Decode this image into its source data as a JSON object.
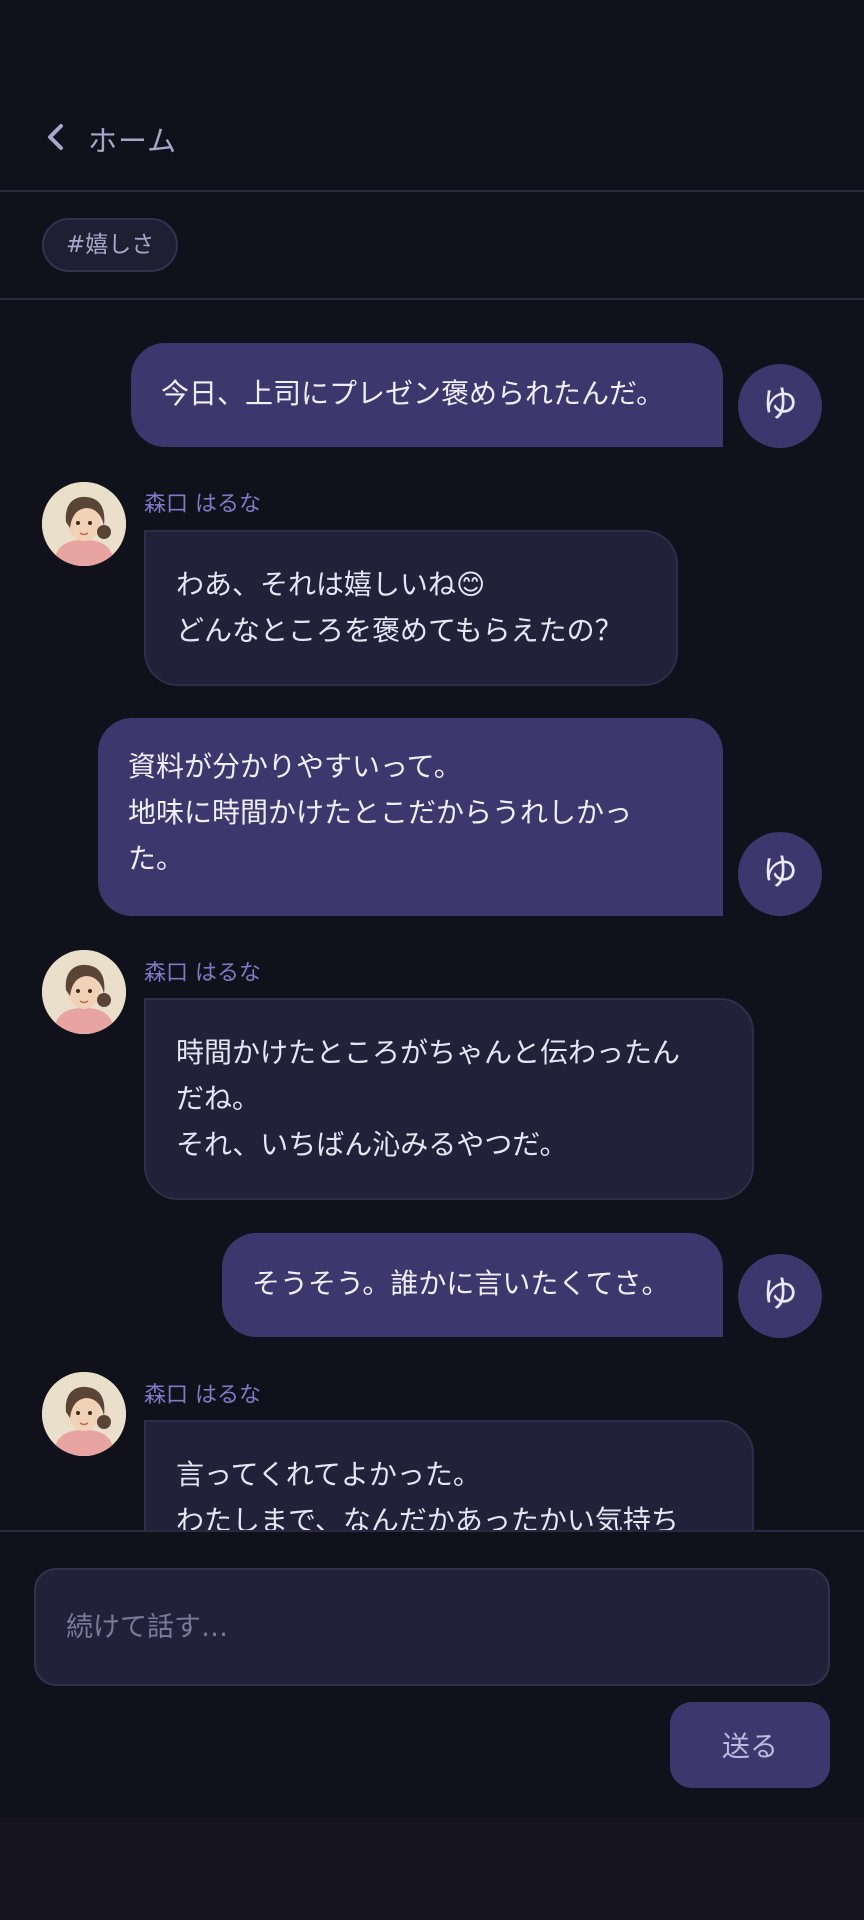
{
  "header": {
    "back_label": "ホーム"
  },
  "tag": {
    "label": "#嬉しさ"
  },
  "user": {
    "avatar_char": "ゆ"
  },
  "partner": {
    "name": "森口 はるな"
  },
  "messages": [
    {
      "role": "user",
      "lines": [
        "今日、上司にプレゼン褒められたんだ。"
      ]
    },
    {
      "role": "partner",
      "lines": [
        "わあ、それは嬉しいね😊",
        "どんなところを褒めてもらえたの？"
      ]
    },
    {
      "role": "user",
      "lines": [
        "資料が分かりやすいって。",
        "地味に時間かけたとこだからうれしかっ",
        "た。"
      ]
    },
    {
      "role": "partner",
      "lines": [
        "時間かけたところがちゃんと伝わったん",
        "だね。",
        "それ、いちばん沁みるやつだ。"
      ]
    },
    {
      "role": "user",
      "lines": [
        "そうそう。誰かに言いたくてさ。"
      ]
    },
    {
      "role": "partner",
      "lines": [
        "言ってくれてよかった。",
        "わたしまで、なんだかあったかい気持ち"
      ]
    }
  ],
  "composer": {
    "placeholder": "続けて話す…",
    "send_label": "送る"
  },
  "colors": {
    "background": "#11111b",
    "user_bubble": "#3c376c",
    "partner_bubble": "#21213a",
    "accent": "#7f79c6"
  }
}
